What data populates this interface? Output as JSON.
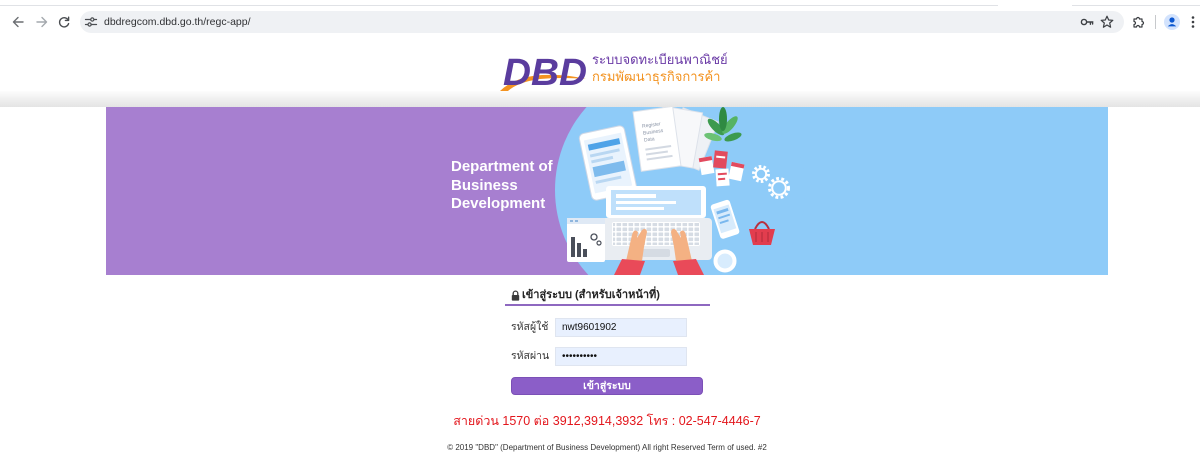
{
  "browser": {
    "url": "dbdregcom.dbd.go.th/regc-app/",
    "icons": {
      "back": "back-arrow-icon",
      "forward": "forward-arrow-icon",
      "reload": "reload-icon",
      "site_info": "tune-icon",
      "password_manager": "key-icon",
      "bookmark": "star-icon",
      "extensions": "puzzle-icon",
      "profile": "profile-avatar-icon",
      "menu": "kebab-menu-icon"
    }
  },
  "header": {
    "logo_text": "DBD",
    "system_name": "ระบบจดทะเบียนพาณิชย์",
    "department_name": "กรมพัฒนาธุรกิจการค้า"
  },
  "banner": {
    "title_lines": [
      "Department of",
      "Business",
      "Development"
    ],
    "document_text": [
      "Register",
      "Business",
      "Data"
    ]
  },
  "login": {
    "lock_icon": "lock-icon",
    "title": "เข้าสู่ระบบ (สำหรับเจ้าหน้าที่)",
    "username_label": "รหัสผู้ใช้",
    "username_value": "nwt9601902",
    "password_label": "รหัสผ่าน",
    "password_value": "••••••••••",
    "submit_label": "เข้าสู่ระบบ"
  },
  "hotline": "สายด่วน 1570 ต่อ 3912,3914,3932 โทร : 02-547-4446-7",
  "footer": "© 2019 \"DBD\" (Department of Business Development) All right Reserved Term of used. #2",
  "colors": {
    "brand_purple": "#5a3c9e",
    "brand_orange": "#f39321",
    "banner_purple": "#a77fd0",
    "banner_blue": "#8ecbf8",
    "button_purple": "#8b5ec8",
    "hotline_red": "#e3161c",
    "autofill_blue": "#e8f0fe"
  }
}
